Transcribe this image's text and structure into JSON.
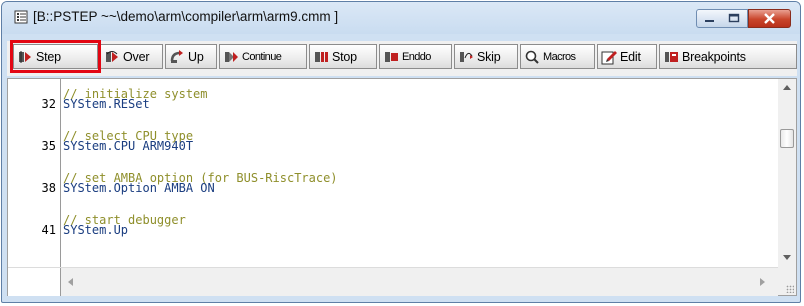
{
  "window": {
    "title": "[B::PSTEP ~~\\demo\\arm\\compiler\\arm\\arm9.cmm ]",
    "controls": [
      "minimize",
      "maximize",
      "close"
    ]
  },
  "toolbar": {
    "buttons": [
      {
        "label": "Step",
        "icon": "step-icon",
        "highlighted": true
      },
      {
        "label": "Over",
        "icon": "step-over-icon"
      },
      {
        "label": "Up",
        "icon": "step-up-icon"
      },
      {
        "label": "Continue",
        "icon": "continue-icon"
      },
      {
        "label": "Stop",
        "icon": "stop-icon"
      },
      {
        "label": "Enddo",
        "icon": "enddo-icon"
      },
      {
        "label": "Skip",
        "icon": "skip-icon"
      },
      {
        "label": "Macros",
        "icon": "macros-icon"
      },
      {
        "label": "Edit",
        "icon": "edit-icon"
      },
      {
        "label": "Breakpoints",
        "icon": "breakpoints-icon"
      }
    ],
    "highlight_color": "#e30613"
  },
  "editor": {
    "lines": [
      {
        "num": "",
        "text": "// initialize system",
        "kind": "comment"
      },
      {
        "num": "32",
        "text": "SYStem.RESet",
        "kind": "command"
      },
      {
        "num": "",
        "text": "// select CPU type",
        "kind": "comment"
      },
      {
        "num": "35",
        "text": "SYStem.CPU ARM940T",
        "kind": "command"
      },
      {
        "num": "",
        "text": "// set AMBA option (for BUS-RiscTrace)",
        "kind": "comment"
      },
      {
        "num": "38",
        "text": "SYStem.Option AMBA ON",
        "kind": "command"
      },
      {
        "num": "",
        "text": "// start debugger",
        "kind": "comment"
      },
      {
        "num": "41",
        "text": "SYStem.Up",
        "kind": "command"
      }
    ],
    "comment_color": "#8f8f2b",
    "command_color": "#1a3d80"
  }
}
